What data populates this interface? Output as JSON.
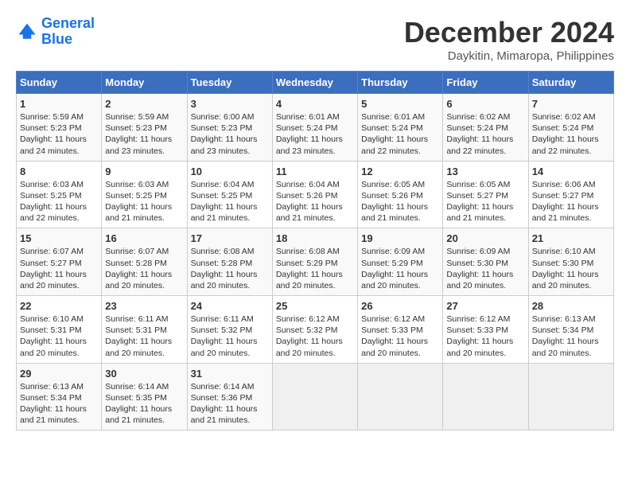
{
  "header": {
    "logo_line1": "General",
    "logo_line2": "Blue",
    "month": "December 2024",
    "location": "Daykitin, Mimaropa, Philippines"
  },
  "days_of_week": [
    "Sunday",
    "Monday",
    "Tuesday",
    "Wednesday",
    "Thursday",
    "Friday",
    "Saturday"
  ],
  "weeks": [
    [
      {
        "day": "1",
        "text": "Sunrise: 5:59 AM\nSunset: 5:23 PM\nDaylight: 11 hours and 24 minutes."
      },
      {
        "day": "2",
        "text": "Sunrise: 5:59 AM\nSunset: 5:23 PM\nDaylight: 11 hours and 23 minutes."
      },
      {
        "day": "3",
        "text": "Sunrise: 6:00 AM\nSunset: 5:23 PM\nDaylight: 11 hours and 23 minutes."
      },
      {
        "day": "4",
        "text": "Sunrise: 6:01 AM\nSunset: 5:24 PM\nDaylight: 11 hours and 23 minutes."
      },
      {
        "day": "5",
        "text": "Sunrise: 6:01 AM\nSunset: 5:24 PM\nDaylight: 11 hours and 22 minutes."
      },
      {
        "day": "6",
        "text": "Sunrise: 6:02 AM\nSunset: 5:24 PM\nDaylight: 11 hours and 22 minutes."
      },
      {
        "day": "7",
        "text": "Sunrise: 6:02 AM\nSunset: 5:24 PM\nDaylight: 11 hours and 22 minutes."
      }
    ],
    [
      {
        "day": "8",
        "text": "Sunrise: 6:03 AM\nSunset: 5:25 PM\nDaylight: 11 hours and 22 minutes."
      },
      {
        "day": "9",
        "text": "Sunrise: 6:03 AM\nSunset: 5:25 PM\nDaylight: 11 hours and 21 minutes."
      },
      {
        "day": "10",
        "text": "Sunrise: 6:04 AM\nSunset: 5:25 PM\nDaylight: 11 hours and 21 minutes."
      },
      {
        "day": "11",
        "text": "Sunrise: 6:04 AM\nSunset: 5:26 PM\nDaylight: 11 hours and 21 minutes."
      },
      {
        "day": "12",
        "text": "Sunrise: 6:05 AM\nSunset: 5:26 PM\nDaylight: 11 hours and 21 minutes."
      },
      {
        "day": "13",
        "text": "Sunrise: 6:05 AM\nSunset: 5:27 PM\nDaylight: 11 hours and 21 minutes."
      },
      {
        "day": "14",
        "text": "Sunrise: 6:06 AM\nSunset: 5:27 PM\nDaylight: 11 hours and 21 minutes."
      }
    ],
    [
      {
        "day": "15",
        "text": "Sunrise: 6:07 AM\nSunset: 5:27 PM\nDaylight: 11 hours and 20 minutes."
      },
      {
        "day": "16",
        "text": "Sunrise: 6:07 AM\nSunset: 5:28 PM\nDaylight: 11 hours and 20 minutes."
      },
      {
        "day": "17",
        "text": "Sunrise: 6:08 AM\nSunset: 5:28 PM\nDaylight: 11 hours and 20 minutes."
      },
      {
        "day": "18",
        "text": "Sunrise: 6:08 AM\nSunset: 5:29 PM\nDaylight: 11 hours and 20 minutes."
      },
      {
        "day": "19",
        "text": "Sunrise: 6:09 AM\nSunset: 5:29 PM\nDaylight: 11 hours and 20 minutes."
      },
      {
        "day": "20",
        "text": "Sunrise: 6:09 AM\nSunset: 5:30 PM\nDaylight: 11 hours and 20 minutes."
      },
      {
        "day": "21",
        "text": "Sunrise: 6:10 AM\nSunset: 5:30 PM\nDaylight: 11 hours and 20 minutes."
      }
    ],
    [
      {
        "day": "22",
        "text": "Sunrise: 6:10 AM\nSunset: 5:31 PM\nDaylight: 11 hours and 20 minutes."
      },
      {
        "day": "23",
        "text": "Sunrise: 6:11 AM\nSunset: 5:31 PM\nDaylight: 11 hours and 20 minutes."
      },
      {
        "day": "24",
        "text": "Sunrise: 6:11 AM\nSunset: 5:32 PM\nDaylight: 11 hours and 20 minutes."
      },
      {
        "day": "25",
        "text": "Sunrise: 6:12 AM\nSunset: 5:32 PM\nDaylight: 11 hours and 20 minutes."
      },
      {
        "day": "26",
        "text": "Sunrise: 6:12 AM\nSunset: 5:33 PM\nDaylight: 11 hours and 20 minutes."
      },
      {
        "day": "27",
        "text": "Sunrise: 6:12 AM\nSunset: 5:33 PM\nDaylight: 11 hours and 20 minutes."
      },
      {
        "day": "28",
        "text": "Sunrise: 6:13 AM\nSunset: 5:34 PM\nDaylight: 11 hours and 20 minutes."
      }
    ],
    [
      {
        "day": "29",
        "text": "Sunrise: 6:13 AM\nSunset: 5:34 PM\nDaylight: 11 hours and 21 minutes."
      },
      {
        "day": "30",
        "text": "Sunrise: 6:14 AM\nSunset: 5:35 PM\nDaylight: 11 hours and 21 minutes."
      },
      {
        "day": "31",
        "text": "Sunrise: 6:14 AM\nSunset: 5:36 PM\nDaylight: 11 hours and 21 minutes."
      },
      {
        "day": "",
        "text": ""
      },
      {
        "day": "",
        "text": ""
      },
      {
        "day": "",
        "text": ""
      },
      {
        "day": "",
        "text": ""
      }
    ]
  ]
}
